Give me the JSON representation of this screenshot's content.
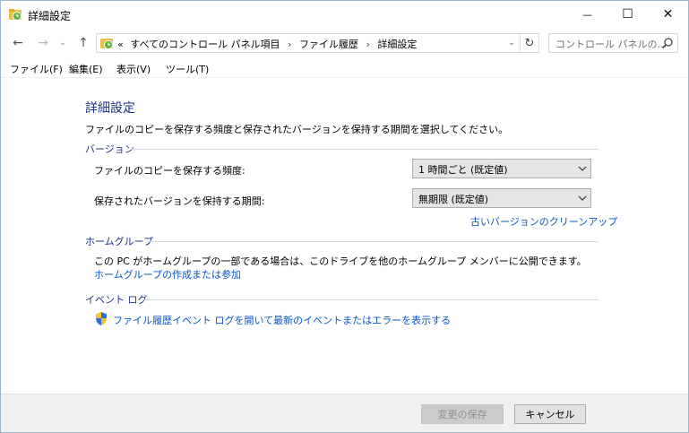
{
  "window": {
    "title": "詳細設定",
    "controls": {
      "minimize": "—",
      "maximize": "☐",
      "close": "✕"
    }
  },
  "navigation": {
    "back_icon": "←",
    "forward_icon": "→",
    "recent_icon": "⌄",
    "up_icon": "↑",
    "address": {
      "prefix": "«",
      "breadcrumb": [
        "すべてのコントロール パネル項目",
        "ファイル履歴",
        "詳細設定"
      ],
      "separator": "›",
      "dropdown_icon": "⌄",
      "refresh_icon": "↻"
    },
    "search": {
      "placeholder": "コントロール パネルの..."
    }
  },
  "menu": [
    "ファイル(F)",
    "編集(E)",
    "表示(V)",
    "ツール(T)"
  ],
  "content": {
    "title": "詳細設定",
    "description": "ファイルのコピーを保存する頻度と保存されたバージョンを保持する期間を選択してください。",
    "versions": {
      "heading": "バージョン",
      "frequency_label": "ファイルのコピーを保存する頻度:",
      "frequency_value": "1 時間ごと (既定値)",
      "retention_label": "保存されたバージョンを保持する期間:",
      "retention_value": "無期限 (既定値)",
      "cleanup_link": "古いバージョンのクリーンアップ"
    },
    "homegroup": {
      "heading": "ホームグループ",
      "text": "この PC がホームグループの一部である場合は、このドライブを他のホームグループ メンバーに公開できます。",
      "link": "ホームグループの作成または参加"
    },
    "eventlog": {
      "heading": "イベント ログ",
      "link": "ファイル履歴イベント ログを開いて最新のイベントまたはエラーを表示する"
    }
  },
  "footer": {
    "save_label": "変更の保存",
    "cancel_label": "キャンセル"
  },
  "colors": {
    "heading": "#1e3287",
    "link": "#0a55c2",
    "footer_bg": "#f0f0f0"
  }
}
